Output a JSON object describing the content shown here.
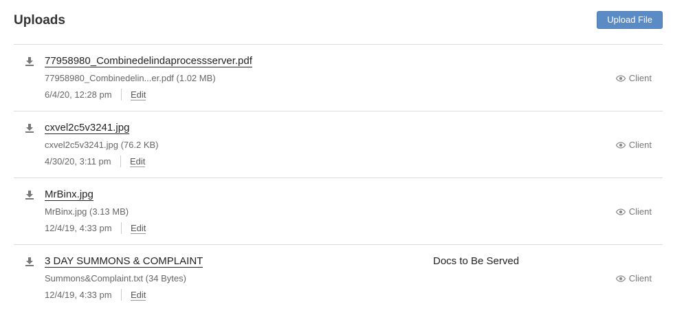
{
  "header": {
    "title": "Uploads",
    "upload_button": "Upload File"
  },
  "colors": {
    "accent": "#5b8bc4",
    "divider": "#dcdcdc"
  },
  "uploads": [
    {
      "title": "77958980_Combinedelindaprocessserver.pdf",
      "meta": "77958980_Combinedelin...er.pdf (1.02 MB)",
      "date": "6/4/20, 12:28 pm",
      "edit": "Edit",
      "category": "",
      "visibility": "Client"
    },
    {
      "title": "cxvel2c5v3241.jpg",
      "meta": "cxvel2c5v3241.jpg (76.2 KB)",
      "date": "4/30/20, 3:11 pm",
      "edit": "Edit",
      "category": "",
      "visibility": "Client"
    },
    {
      "title": "MrBinx.jpg",
      "meta": "MrBinx.jpg (3.13 MB)",
      "date": "12/4/19, 4:33 pm",
      "edit": "Edit",
      "category": "",
      "visibility": "Client"
    },
    {
      "title": "3 DAY SUMMONS & COMPLAINT",
      "meta": "Summons&Complaint.txt (34 Bytes)",
      "date": "12/4/19, 4:33 pm",
      "edit": "Edit",
      "category": "Docs to Be Served",
      "visibility": "Client"
    }
  ]
}
